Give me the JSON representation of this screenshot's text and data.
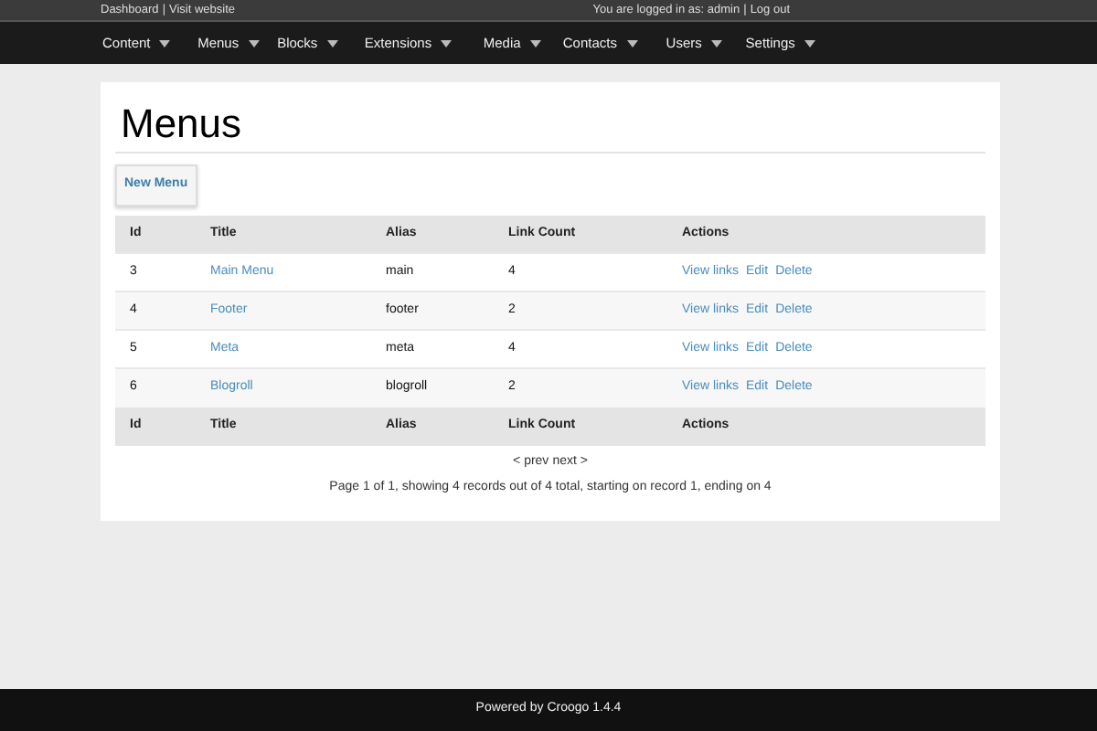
{
  "top_bar": {
    "left_links": [
      "Dashboard",
      "Visit website"
    ],
    "left_separator": "|",
    "login_text": "You are logged in as: admin",
    "right_separator": "|",
    "logout": "Log out"
  },
  "nav": [
    {
      "label": "Content"
    },
    {
      "label": "Menus"
    },
    {
      "label": "Blocks"
    },
    {
      "label": "Extensions"
    },
    {
      "label": "Media"
    },
    {
      "label": "Contacts"
    },
    {
      "label": "Users"
    },
    {
      "label": "Settings"
    }
  ],
  "page_title": "Menus",
  "new_button": "New Menu",
  "table": {
    "columns": [
      "Id",
      "Title",
      "Alias",
      "Link Count",
      "Actions"
    ],
    "rows": [
      {
        "id": "3",
        "title": "Main Menu",
        "alias": "main",
        "link_count": "4",
        "actions": [
          "View links",
          "Edit",
          "Delete"
        ]
      },
      {
        "id": "4",
        "title": "Footer",
        "alias": "footer",
        "link_count": "2",
        "actions": [
          "View links",
          "Edit",
          "Delete"
        ]
      },
      {
        "id": "5",
        "title": "Meta",
        "alias": "meta",
        "link_count": "4",
        "actions": [
          "View links",
          "Edit",
          "Delete"
        ]
      },
      {
        "id": "6",
        "title": "Blogroll",
        "alias": "blogroll",
        "link_count": "2",
        "actions": [
          "View links",
          "Edit",
          "Delete"
        ]
      }
    ],
    "footer_columns": [
      "Id",
      "Title",
      "Alias",
      "Link Count",
      "Actions"
    ]
  },
  "pager": {
    "prev": "< prev",
    "next": "next >"
  },
  "summary": "Page 1 of 1, showing 4 records out of 4 total, starting on record 1, ending on 4",
  "footer": "Powered by Croogo 1.4.4"
}
